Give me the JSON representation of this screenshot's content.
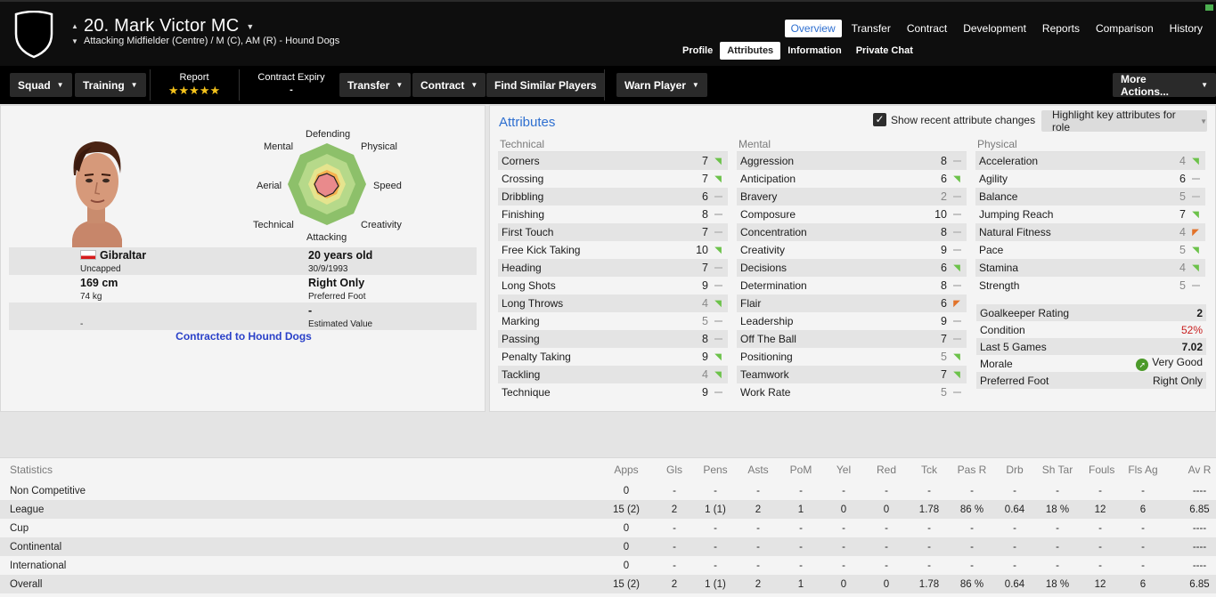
{
  "header": {
    "player_name": "20. Mark Victor MC",
    "subtitle": "Attacking Midfielder (Centre) / M (C), AM (R) - Hound Dogs",
    "tabs": [
      "Overview",
      "Transfer",
      "Contract",
      "Development",
      "Reports",
      "Comparison",
      "History"
    ],
    "active_tab": "Overview",
    "sub_tabs": [
      "Profile",
      "Attributes",
      "Information",
      "Private Chat"
    ],
    "active_sub_tab": "Attributes"
  },
  "toolbar": {
    "squad": "Squad",
    "training": "Training",
    "report_label": "Report",
    "report_stars": "★★★★★",
    "contract_expiry_label": "Contract Expiry",
    "contract_expiry_value": "-",
    "transfer": "Transfer",
    "contract": "Contract",
    "find_similar": "Find Similar Players",
    "warn_player": "Warn Player",
    "more_actions": "More Actions..."
  },
  "profile": {
    "radar_labels": {
      "defending": "Defending",
      "physical": "Physical",
      "speed": "Speed",
      "creativity": "Creativity",
      "attacking": "Attacking",
      "technical": "Technical",
      "aerial": "Aerial",
      "mental": "Mental"
    },
    "nationality": "Gibraltar",
    "caps": "Uncapped",
    "age": "20 years old",
    "dob": "30/9/1993",
    "height": "169 cm",
    "weight": "74 kg",
    "preferred_foot": "Right Only",
    "preferred_foot_label": "Preferred Foot",
    "value": "-",
    "value_label": "Estimated Value",
    "other": "-",
    "contract_status": "Contracted to Hound Dogs"
  },
  "attributes": {
    "title": "Attributes",
    "show_recent_label": "Show recent attribute changes",
    "highlight_label": "Highlight key attributes for role",
    "technical_head": "Technical",
    "mental_head": "Mental",
    "physical_head": "Physical",
    "technical": [
      {
        "name": "Corners",
        "value": "7",
        "trend": "up"
      },
      {
        "name": "Crossing",
        "value": "7",
        "trend": "up"
      },
      {
        "name": "Dribbling",
        "value": "6",
        "trend": "same"
      },
      {
        "name": "Finishing",
        "value": "8",
        "trend": "same"
      },
      {
        "name": "First Touch",
        "value": "7",
        "trend": "same"
      },
      {
        "name": "Free Kick Taking",
        "value": "10",
        "trend": "up"
      },
      {
        "name": "Heading",
        "value": "7",
        "trend": "same"
      },
      {
        "name": "Long Shots",
        "value": "9",
        "trend": "same"
      },
      {
        "name": "Long Throws",
        "value": "4",
        "trend": "up"
      },
      {
        "name": "Marking",
        "value": "5",
        "trend": "same"
      },
      {
        "name": "Passing",
        "value": "8",
        "trend": "same"
      },
      {
        "name": "Penalty Taking",
        "value": "9",
        "trend": "up"
      },
      {
        "name": "Tackling",
        "value": "4",
        "trend": "up"
      },
      {
        "name": "Technique",
        "value": "9",
        "trend": "same"
      }
    ],
    "mental": [
      {
        "name": "Aggression",
        "value": "8",
        "trend": "same"
      },
      {
        "name": "Anticipation",
        "value": "6",
        "trend": "up"
      },
      {
        "name": "Bravery",
        "value": "2",
        "trend": "same"
      },
      {
        "name": "Composure",
        "value": "10",
        "trend": "same"
      },
      {
        "name": "Concentration",
        "value": "8",
        "trend": "same"
      },
      {
        "name": "Creativity",
        "value": "9",
        "trend": "same"
      },
      {
        "name": "Decisions",
        "value": "6",
        "trend": "up"
      },
      {
        "name": "Determination",
        "value": "8",
        "trend": "same"
      },
      {
        "name": "Flair",
        "value": "6",
        "trend": "down"
      },
      {
        "name": "Leadership",
        "value": "9",
        "trend": "same"
      },
      {
        "name": "Off The Ball",
        "value": "7",
        "trend": "same"
      },
      {
        "name": "Positioning",
        "value": "5",
        "trend": "up"
      },
      {
        "name": "Teamwork",
        "value": "7",
        "trend": "up"
      },
      {
        "name": "Work Rate",
        "value": "5",
        "trend": "same"
      }
    ],
    "physical": [
      {
        "name": "Acceleration",
        "value": "4",
        "trend": "up"
      },
      {
        "name": "Agility",
        "value": "6",
        "trend": "same"
      },
      {
        "name": "Balance",
        "value": "5",
        "trend": "same"
      },
      {
        "name": "Jumping Reach",
        "value": "7",
        "trend": "up"
      },
      {
        "name": "Natural Fitness",
        "value": "4",
        "trend": "down"
      },
      {
        "name": "Pace",
        "value": "5",
        "trend": "up"
      },
      {
        "name": "Stamina",
        "value": "4",
        "trend": "up"
      },
      {
        "name": "Strength",
        "value": "5",
        "trend": "same"
      }
    ],
    "extra": [
      {
        "k": "Goalkeeper Rating",
        "v": "2"
      },
      {
        "k": "Condition",
        "v": "52%",
        "color": "#c81e1e"
      },
      {
        "k": "Last 5 Games",
        "v": "7.02"
      },
      {
        "k": "Morale",
        "v": "Very Good",
        "icon": "morale-icon"
      },
      {
        "k": "Preferred Foot",
        "v": "Right Only"
      }
    ]
  },
  "statistics": {
    "headers": [
      "Statistics",
      "Apps",
      "Gls",
      "Pens",
      "Asts",
      "PoM",
      "Yel",
      "Red",
      "Tck",
      "Pas R",
      "Drb",
      "Sh Tar",
      "Fouls",
      "Fls Ag",
      "Av R"
    ],
    "rows": [
      [
        "Non Competitive",
        "0",
        "-",
        "-",
        "-",
        "-",
        "-",
        "-",
        "-",
        "-",
        "-",
        "-",
        "-",
        "-",
        "----"
      ],
      [
        "League",
        "15 (2)",
        "2",
        "1 (1)",
        "2",
        "1",
        "0",
        "0",
        "1.78",
        "86 %",
        "0.64",
        "18 %",
        "12",
        "6",
        "6.85"
      ],
      [
        "Cup",
        "0",
        "-",
        "-",
        "-",
        "-",
        "-",
        "-",
        "-",
        "-",
        "-",
        "-",
        "-",
        "-",
        "----"
      ],
      [
        "Continental",
        "0",
        "-",
        "-",
        "-",
        "-",
        "-",
        "-",
        "-",
        "-",
        "-",
        "-",
        "-",
        "-",
        "----"
      ],
      [
        "International",
        "0",
        "-",
        "-",
        "-",
        "-",
        "-",
        "-",
        "-",
        "-",
        "-",
        "-",
        "-",
        "-",
        "----"
      ],
      [
        "Overall",
        "15 (2)",
        "2",
        "1 (1)",
        "2",
        "1",
        "0",
        "0",
        "1.78",
        "86 %",
        "0.64",
        "18 %",
        "12",
        "6",
        "6.85"
      ]
    ]
  },
  "colors": {
    "accent": "#2e6fd0",
    "trend_up": "#6cc24a",
    "trend_down": "#e2732a",
    "stars": "#f4c21b"
  }
}
